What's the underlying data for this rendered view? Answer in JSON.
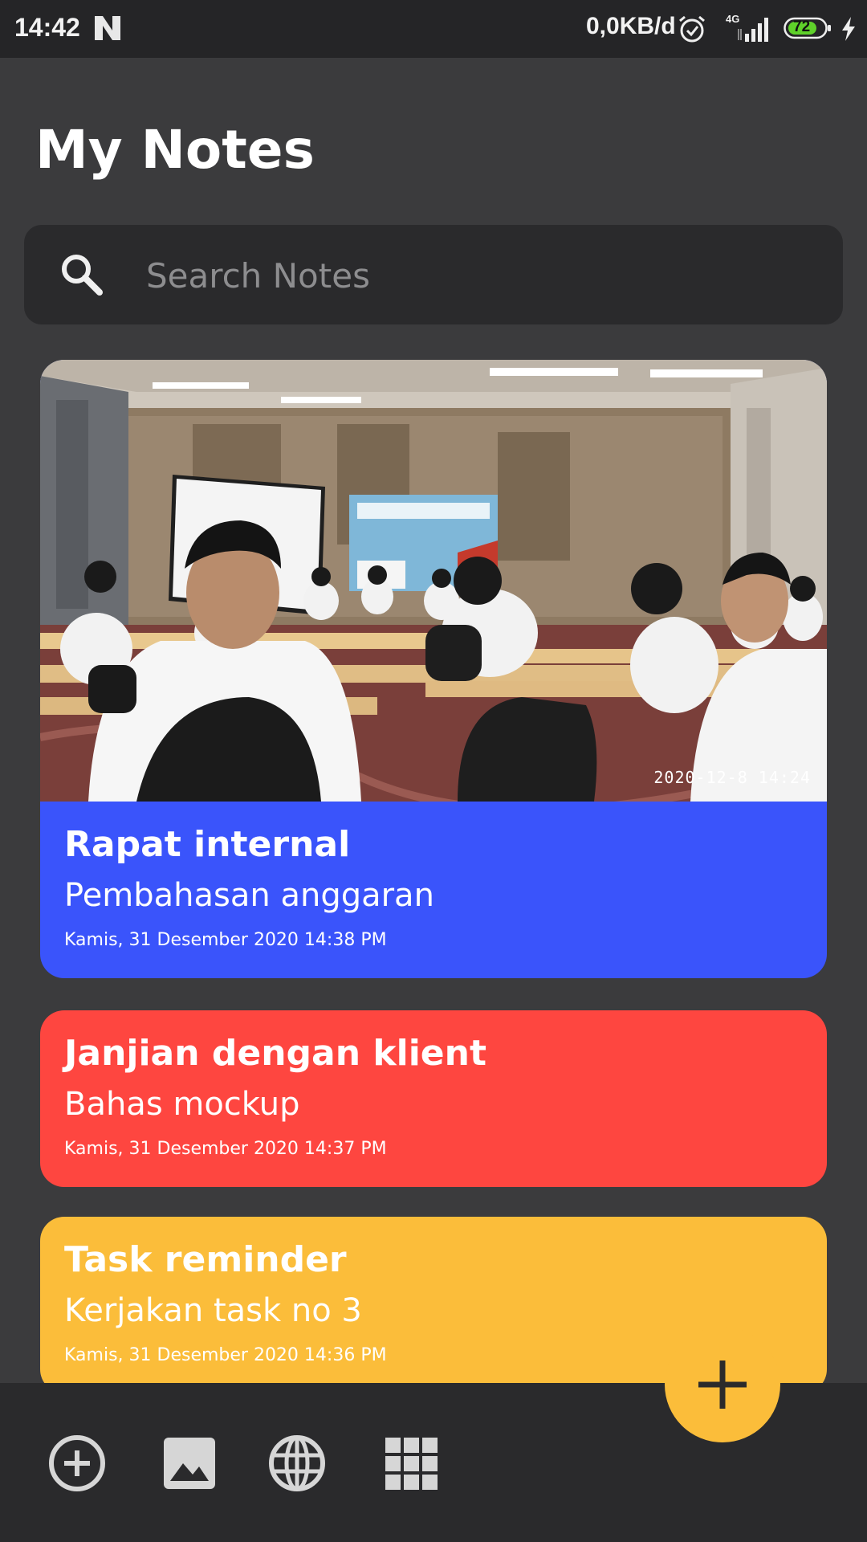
{
  "status_bar": {
    "time": "14:42",
    "network_speed": "0,0KB/d",
    "network_type": "4G",
    "battery_level": "72"
  },
  "header": {
    "title": "My Notes"
  },
  "search": {
    "placeholder": "Search Notes",
    "value": ""
  },
  "notes": [
    {
      "title": "Rapat internal",
      "subtitle": "Pembahasan anggaran",
      "date": "Kamis, 31 Desember 2020 14:38 PM",
      "color": "#3a54fb",
      "has_image": true,
      "image_stamp": "2020-12-8 14:24"
    },
    {
      "title": "Janjian dengan klient",
      "subtitle": "Bahas mockup",
      "date": "Kamis, 31 Desember 2020 14:37 PM",
      "color": "#fe4640",
      "has_image": false
    },
    {
      "title": "Task reminder",
      "subtitle": "Kerjakan task no 3",
      "date": "Kamis, 31 Desember 2020 14:36 PM",
      "color": "#fbbd3a",
      "has_image": false
    }
  ],
  "bottom_bar": {
    "icons": [
      "add-circle-icon",
      "image-icon",
      "globe-icon",
      "grid-icon"
    ]
  },
  "fab": {
    "icon": "plus-icon",
    "color": "#fbbd3a"
  },
  "colors": {
    "background": "#3b3b3d",
    "surface": "#2a2a2c",
    "status_bar": "#252527"
  }
}
